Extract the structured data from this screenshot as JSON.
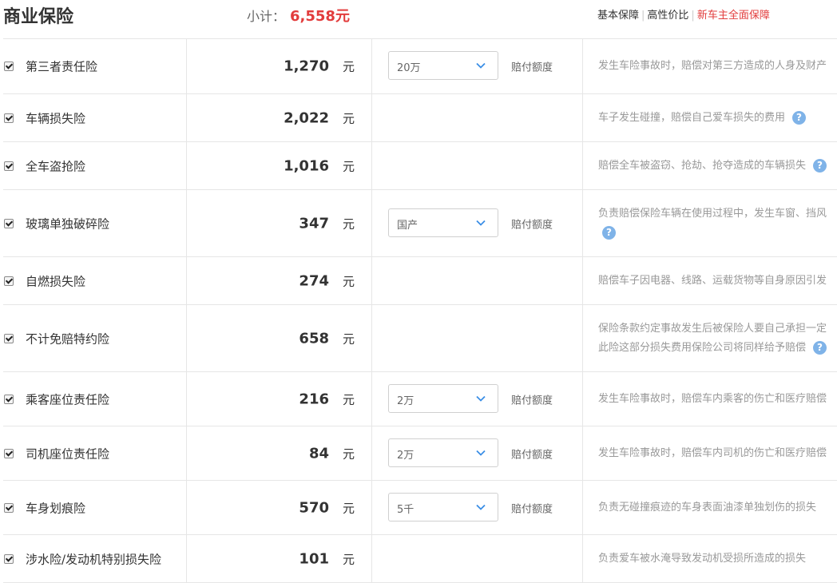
{
  "header": {
    "title": "商业保险",
    "subtotal_label": "小计：",
    "subtotal_value": "6,558元",
    "plans": [
      "基本保障",
      "高性价比",
      "新车主全面保障"
    ]
  },
  "colors": {
    "accent": "#e23c3c",
    "help": "#7fb3e8"
  },
  "rows": [
    {
      "name": "第三者责任险",
      "price": "1,270",
      "unit": "元",
      "select": "20万",
      "field": "赔付额度",
      "desc": [
        "发生车险事故时，赔偿对第三方造成的人身及财产"
      ]
    },
    {
      "name": "车辆损失险",
      "price": "2,022",
      "unit": "元",
      "desc": [
        "车子发生碰撞，赔偿自己爱车损失的费用"
      ]
    },
    {
      "name": "全车盗抢险",
      "price": "1,016",
      "unit": "元",
      "desc": [
        "赔偿全车被盗窃、抢劫、抢夺造成的车辆损失"
      ]
    },
    {
      "name": "玻璃单独破碎险",
      "price": "347",
      "unit": "元",
      "select": "国产",
      "field": "赔付额度",
      "desc": [
        "负责赔偿保险车辆在使用过程中，发生车窗、挡风"
      ]
    },
    {
      "name": "自燃损失险",
      "price": "274",
      "unit": "元",
      "desc": [
        "赔偿车子因电器、线路、运载货物等自身原因引发"
      ]
    },
    {
      "name": "不计免赔特约险",
      "price": "658",
      "unit": "元",
      "desc": [
        "保险条款约定事故发生后被保险人要自己承担一定",
        "此险这部分损失费用保险公司将同样给予赔偿"
      ]
    },
    {
      "name": "乘客座位责任险",
      "price": "216",
      "unit": "元",
      "select": "2万",
      "field": "赔付额度",
      "desc": [
        "发生车险事故时，赔偿车内乘客的伤亡和医疗赔偿"
      ]
    },
    {
      "name": "司机座位责任险",
      "price": "84",
      "unit": "元",
      "select": "2万",
      "field": "赔付额度",
      "desc": [
        "发生车险事故时，赔偿车内司机的伤亡和医疗赔偿"
      ]
    },
    {
      "name": "车身划痕险",
      "price": "570",
      "unit": "元",
      "select": "5千",
      "field": "赔付额度",
      "desc": [
        "负责无碰撞痕迹的车身表面油漆单独划伤的损失"
      ]
    },
    {
      "name": "涉水险/发动机特别损失险",
      "price": "101",
      "unit": "元",
      "desc": [
        "负责爱车被水淹导致发动机受损所造成的损失"
      ]
    }
  ]
}
